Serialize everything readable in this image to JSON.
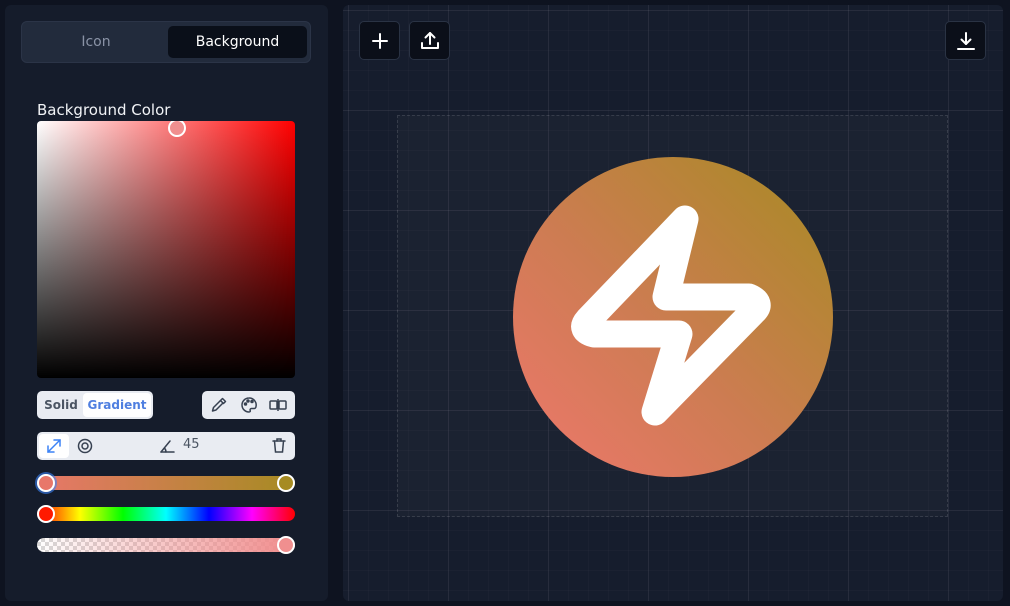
{
  "tabs": {
    "icon": "Icon",
    "background": "Background",
    "active": "background"
  },
  "section": {
    "title": "Background Color"
  },
  "color_picker": {
    "hue_color": "#ff0000",
    "selected_color": "#f08f8f"
  },
  "fill_mode": {
    "solid": "Solid",
    "gradient": "Gradient",
    "active": "gradient"
  },
  "tools": {
    "eyedropper": "eyedropper-icon",
    "palette": "palette-icon",
    "swap": "swap-colors-icon"
  },
  "gradient": {
    "type_linear": "arrows-diagonal-icon",
    "type_radial": "concentric-circles-icon",
    "angle_icon": "angle-icon",
    "angle": "45",
    "delete_icon": "trash-icon",
    "start_color": "#e8776a",
    "end_color": "#a68b22",
    "selected_stop": "start"
  },
  "sliders": {
    "hue_value": 0,
    "alpha_value": 1
  },
  "toolbar": {
    "add_icon": "plus-icon",
    "upload_icon": "upload-icon",
    "download_icon": "download-icon"
  },
  "preview": {
    "icon": "lightning-bolt-icon",
    "icon_color": "#ffffff",
    "background_shape": "circle"
  }
}
